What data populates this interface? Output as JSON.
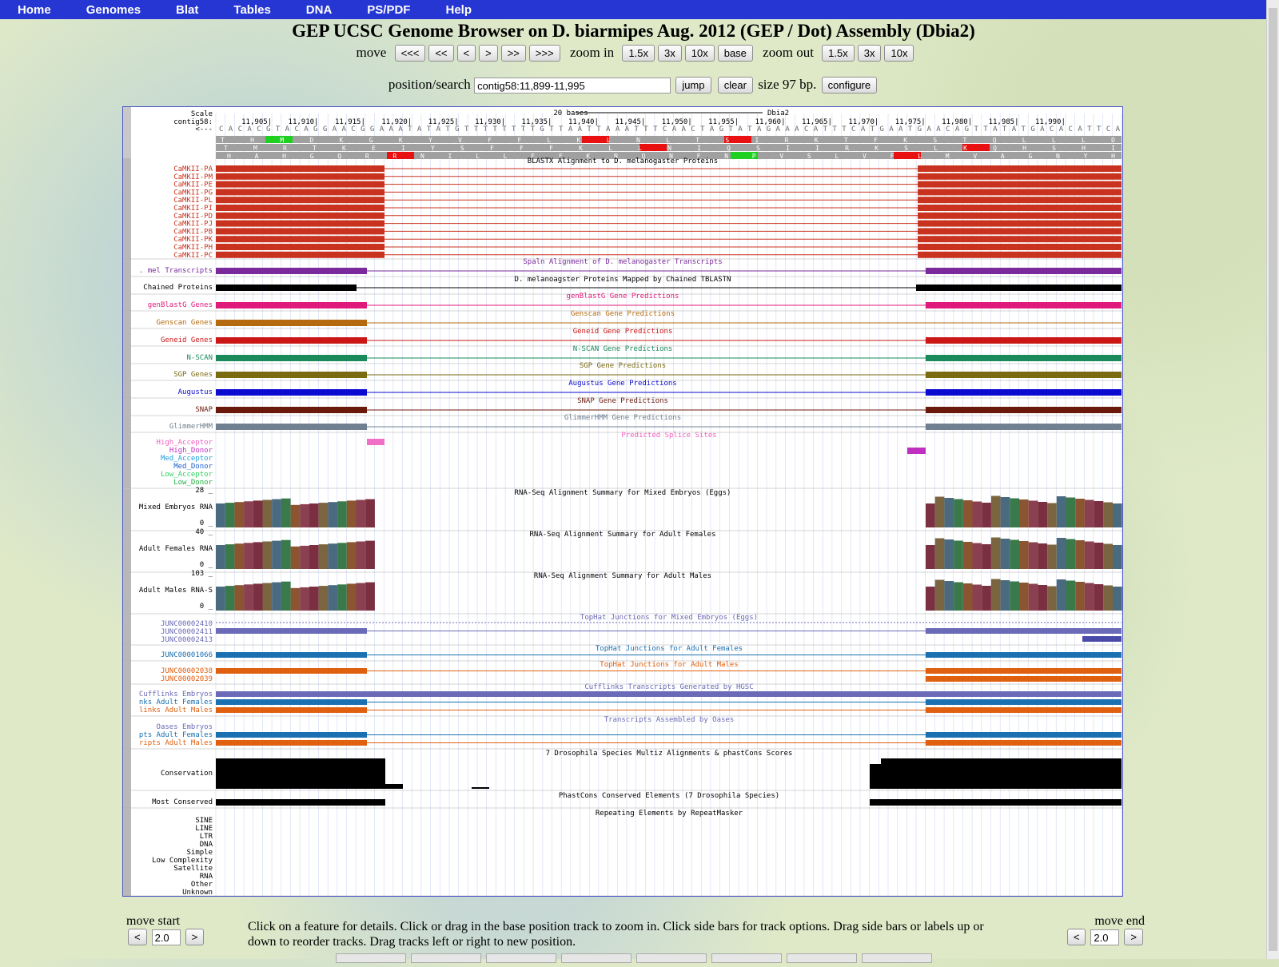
{
  "nav": [
    "Home",
    "Genomes",
    "Blat",
    "Tables",
    "DNA",
    "PS/PDF",
    "Help"
  ],
  "title": "GEP UCSC Genome Browser on D. biarmipes Aug. 2012 (GEP / Dot) Assembly (Dbia2)",
  "move": {
    "move_label": "move",
    "move_buttons": [
      "<<<",
      "<<",
      "<",
      ">",
      ">>",
      ">>>"
    ],
    "zoom_in_label": "zoom in",
    "zoom_in_buttons": [
      "1.5x",
      "3x",
      "10x",
      "base"
    ],
    "zoom_out_label": "zoom out",
    "zoom_out_buttons": [
      "1.5x",
      "3x",
      "10x"
    ]
  },
  "search": {
    "label": "position/search",
    "value": "contig58:11,899-11,995",
    "jump": "jump",
    "clear": "clear",
    "size": "size 97 bp.",
    "configure": "configure"
  },
  "ruler": {
    "scale_label": "Scale",
    "chrom_label": "contig58:",
    "strand_label": "<---",
    "scale_text": "20 bases",
    "assembly": "Dbia2",
    "ticks": [
      "11,905|",
      "11,910|",
      "11,915|",
      "11,920|",
      "11,925|",
      "11,930|",
      "11,935|",
      "11,940|",
      "11,945|",
      "11,950|",
      "11,955|",
      "11,960|",
      "11,965|",
      "11,970|",
      "11,975|",
      "11,980|",
      "11,985|",
      "11,990|"
    ],
    "bases": "CACACGTACAGGAACGGAAATATATGTTTTTTTTGTTAATTAAATTTCAACTAGTATAGAAACATTTCATGAATGAACAGTTATATGACACATTCA",
    "frame1": "THMDKGKYVFFLKLNLTSIRKTFKSTQLLLD",
    "frame2": "TMRTKEIYSFFFKLLNIQSIIRKSLKQHSHI",
    "frame3": "HAHGQRRNILLFFKNQNFNPVSLVFLMVAGNYH"
  },
  "tracks": {
    "blastx": {
      "title": "BLASTX Alignment to D. melanogaster Proteins",
      "labels": [
        "CaMKII-PA",
        "CaMKII-PM",
        "CaMKII-PE",
        "CaMKII-PG",
        "CaMKII-PL",
        "CaMKII-PI",
        "CaMKII-PD",
        "CaMKII-PJ",
        "CaMKII-PB",
        "CaMKII-PK",
        "CaMKII-PH",
        "CaMKII-PC"
      ],
      "color": "#c8321e"
    },
    "spaln": {
      "label": ". mel Transcripts",
      "title": "Spaln Alignment of D. melanogaster Transcripts",
      "color": "#7a2a9a"
    },
    "chained": {
      "label": "Chained Proteins",
      "title": "D. melanoagster Proteins Mapped by Chained TBLASTN",
      "color": "#000000"
    },
    "genblast": {
      "label": "genBlastG Genes",
      "title": "genBlastG Gene Predictions",
      "color": "#e01a7a"
    },
    "genscan": {
      "label": "Genscan Genes",
      "title": "Genscan Gene Predictions",
      "color": "#b56a10"
    },
    "geneid": {
      "label": "Geneid Genes",
      "title": "Geneid Gene Predictions",
      "color": "#cc1515"
    },
    "nscan": {
      "label": "N-SCAN",
      "title": "N-SCAN Gene Predictions",
      "color": "#1a8a5a"
    },
    "sgp": {
      "label": "SGP Genes",
      "title": "SGP Gene Predictions",
      "color": "#7a6a10"
    },
    "augustus": {
      "label": "Augustus",
      "title": "Augustus Gene Predictions",
      "color": "#0a0ad0"
    },
    "snap": {
      "label": "SNAP",
      "title": "SNAP Gene Predictions",
      "color": "#6a1a0a"
    },
    "glimmer": {
      "label": "GlimmerHMM",
      "title": "GlimmerHMM Gene Predictions",
      "color": "#708090"
    },
    "splice": {
      "title": "Predicted Splice Sites",
      "labels": [
        {
          "text": "High_Acceptor",
          "color": "#f060c0"
        },
        {
          "text": "High_Donor",
          "color": "#c030c0"
        },
        {
          "text": "Med_Acceptor",
          "color": "#20a0e0"
        },
        {
          "text": "Med_Donor",
          "color": "#2060d0"
        },
        {
          "text": "Low_Acceptor",
          "color": "#30d060"
        },
        {
          "text": "Low_Donor",
          "color": "#20b040"
        }
      ]
    },
    "rnaseq": [
      {
        "label": "Mixed Embryos RNA",
        "max": "28 _",
        "min": "0 _",
        "title": "RNA-Seq Alignment Summary for Mixed Embryos (Eggs)"
      },
      {
        "label": "Adult Females RNA",
        "max": "40 _",
        "min": "0 _",
        "title": "RNA-Seq Alignment Summary for Adult Females"
      },
      {
        "label": "Adult Males RNA-S",
        "max": "103 _",
        "min": "0 _",
        "title": "RNA-Seq Alignment Summary for Adult Males"
      }
    ],
    "tophat_embryo": {
      "title": "TopHat Junctions for Mixed Embryos (Eggs)",
      "labels": [
        "JUNC00002410",
        "JUNC00002411",
        "JUNC00002413"
      ],
      "color": "#6a6ab8"
    },
    "tophat_female": {
      "title": "TopHat Junctions for Adult Females",
      "labels": [
        "JUNC00001066"
      ],
      "color": "#1a70b0"
    },
    "tophat_male": {
      "title": "TopHat Junctions for Adult Males",
      "labels": [
        "JUNC00002038",
        "JUNC00002039"
      ],
      "color": "#e06010"
    },
    "cufflinks": {
      "title": "Cufflinks Transcripts Generated by HGSC",
      "labels": [
        "Cufflinks Embryos",
        "nks Adult Females",
        "links Adult Males"
      ]
    },
    "oases": {
      "title": "Transcripts Assembled by Oases",
      "labels": [
        "Oases Embryos",
        "pts Adult Females",
        "ripts Adult Males"
      ]
    },
    "conservation": {
      "label": "Conservation",
      "title": "7 Drosophila Species Multiz Alignments & phastCons Scores"
    },
    "most_conserved": {
      "label": "Most Conserved",
      "title": "PhastCons Conserved Elements (7 Drosophila Species)"
    },
    "repeats": {
      "title": "Repeating Elements by RepeatMasker",
      "labels": [
        "SINE",
        "LINE",
        "LTR",
        "DNA",
        "Simple",
        "Low Complexity",
        "Satellite",
        "RNA",
        "Other",
        "Unknown"
      ]
    }
  },
  "bottom": {
    "move_start": "move start",
    "move_end": "move end",
    "start_value": "2.0",
    "end_value": "2.0",
    "left_btn": "<",
    "right_btn": ">",
    "help_text": "Click on a feature for details. Click or drag in the base position track to zoom in. Click side bars for track options. Drag side bars or labels up or down to reorder tracks. Drag tracks left or right to new position."
  }
}
